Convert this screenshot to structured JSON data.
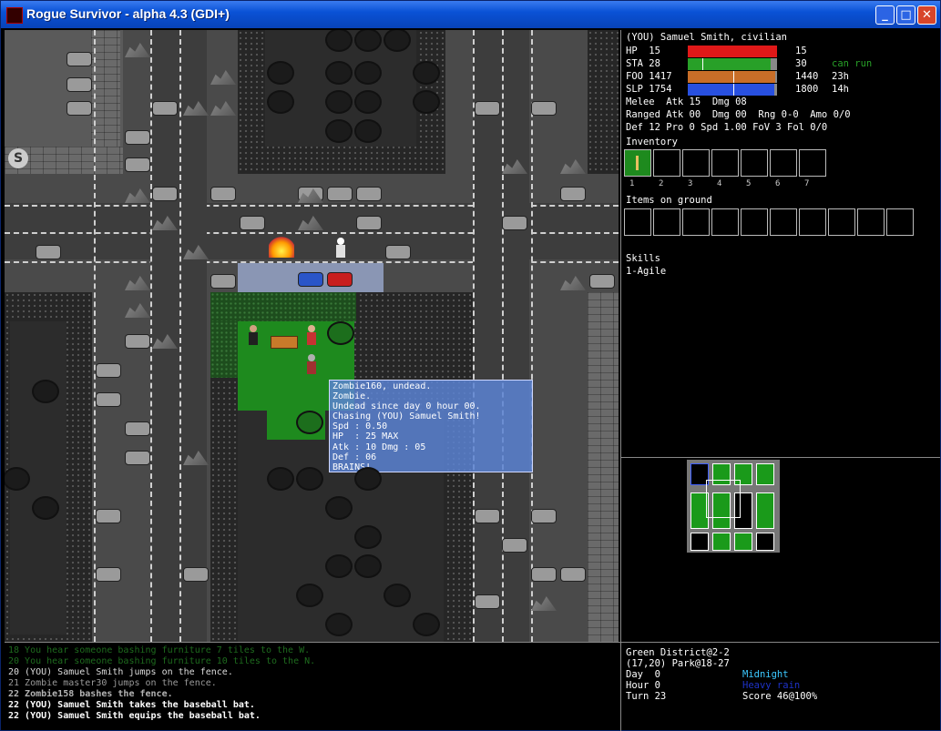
{
  "window": {
    "title": "Rogue Survivor - alpha 4.3 (GDI+)",
    "minimize": "_",
    "maximize": "□",
    "close": "✕"
  },
  "map": {
    "subway_sign": "S"
  },
  "tooltip": {
    "lines": [
      "Zombie160, undead.",
      "Zombie.",
      "Undead since day 0 hour 00.",
      "Chasing (YOU) Samuel Smith!",
      "Spd : 0.50",
      "HP  : 25 MAX",
      "Atk : 10 Dmg : 05",
      "Def : 06",
      "BRAINS!"
    ]
  },
  "player": {
    "header": "(YOU) Samuel Smith, civilian",
    "stats": [
      {
        "label": "HP  15",
        "max": "15",
        "extra": "",
        "color": "#e01818",
        "fill": 1.0
      },
      {
        "label": "STA 28",
        "max": "30",
        "extra": "can run",
        "color": "#28a028",
        "fill": 0.933
      },
      {
        "label": "FOO 1417",
        "max": "1440",
        "extra": "23h",
        "color": "#c86e28",
        "fill": 0.984
      },
      {
        "label": "SLP 1754",
        "max": "1800",
        "extra": "14h",
        "color": "#2850e0",
        "fill": 0.974
      }
    ],
    "melee": "Melee  Atk 15  Dmg 08",
    "ranged": "Ranged Atk 00  Dmg 00  Rng 0-0  Amo 0/0",
    "def": "Def 12 Pro 0 Spd 1.00 FoV 3 Fol 0/0",
    "inventory_label": "Inventory",
    "inventory_numbers": [
      "1",
      "2",
      "3",
      "4",
      "5",
      "6",
      "7"
    ],
    "ground_label": "Items on ground",
    "skills_label": "Skills",
    "skills": [
      "1-Agile"
    ]
  },
  "log": [
    {
      "text": "18 You hear someone bashing furniture 7 tiles to the W.",
      "color": "#1e6b1e",
      "bold": false
    },
    {
      "text": "20 You hear someone bashing furniture 10 tiles to the N.",
      "color": "#1e6b1e",
      "bold": false
    },
    {
      "text": "20 (YOU) Samuel Smith jumps on the fence.",
      "color": "#dcdcdc",
      "bold": false
    },
    {
      "text": "21 Zombie master30 jumps on the fence.",
      "color": "#9a9a9a",
      "bold": false
    },
    {
      "text": "22 Zombie158 bashes the fence.",
      "color": "#b4b4b4",
      "bold": true
    },
    {
      "text": "22 (YOU) Samuel Smith takes the baseball bat.",
      "color": "#ffffff",
      "bold": true
    },
    {
      "text": "22 (YOU) Samuel Smith equips the baseball bat.",
      "color": "#ffffff",
      "bold": true
    }
  ],
  "status": {
    "district": "Green District@2-2",
    "location": "(17,20) Park@18-27",
    "day": "Day  0",
    "hour": "Hour 0",
    "turn": "Turn 23",
    "time_of_day": "Midnight",
    "weather": "Heavy rain",
    "score": "Score 46@100%",
    "colors": {
      "time": "#3cc8ff",
      "weather": "#1e32c8"
    }
  }
}
